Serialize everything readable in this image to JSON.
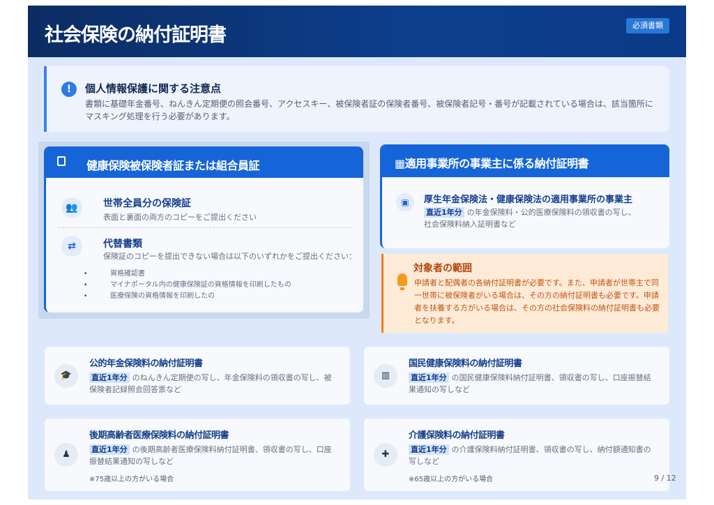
{
  "header": {
    "title": "社会保険の納付証明書",
    "badge": "必須書類"
  },
  "notice": {
    "icon": "exclamation-icon",
    "title": "個人情報保護に関する注意点",
    "text": "書類に基礎年金番号、ねんきん定期便の照会番号、アクセスキー、被保険者証の保険者番号、被保険者記号・番号が記載されている場合は、該当箇所にマスキング処理を行う必要があります。"
  },
  "insurance_card": {
    "icon": "document-icon",
    "title": "健康保険被保険者証または組合員証",
    "items": [
      {
        "icon": "family-icon",
        "title": "世帯全員分の保険証",
        "desc": "表面と裏面の両方のコピーをご提出ください"
      },
      {
        "icon": "swap-icon",
        "title": "代替書類",
        "desc": "保険証のコピーを提出できない場合は以下のいずれかをご提出ください：",
        "bullets": [
          "資格確認書",
          "マイナポータル内の健康保険証の資格情報を印刷したもの",
          "医療保険の資格情報を印刷したの"
        ]
      }
    ]
  },
  "employer_card": {
    "icon": "building-icon",
    "title": "適用事業所の事業主に係る納付証明書",
    "item": {
      "icon": "clipboard-icon",
      "title": "厚生年金保険法・健康保険法の適用事業所の事業主",
      "tag": "直近1年分",
      "desc": "の年金保険料・公的医療保険料の領収書の写し、社会保険料納入証明書など"
    }
  },
  "scope": {
    "icon": "lightbulb-icon",
    "title": "対象者の範囲",
    "text": "申請者と配偶者の各納付証明書が必要です。また、申請者が世帯主で同一世帯に被保険者がいる場合は、その方の納付証明書も必要です。申請者を扶養する方がいる場合は、その方の社会保険料の納付証明書も必要となります。"
  },
  "cards": [
    {
      "icon": "graduation-cap-icon",
      "glyph": "🎓",
      "title": "公的年金保険料の納付証明書",
      "tag": "直近1年分",
      "desc": "のねんきん定期便の写し、年金保険料の領収書の写し、被保険者記録照会回答票など",
      "note": ""
    },
    {
      "icon": "hospital-icon",
      "glyph": "▥",
      "title": "国民健康保険料の納付証明書",
      "tag": "直近1年分",
      "desc": "の国民健康保険料納付証明書、領収書の写し、口座振替結果通知の写しなど",
      "note": ""
    },
    {
      "icon": "elderly-person-icon",
      "glyph": "♟",
      "title": "後期高齢者医療保険料の納付証明書",
      "tag": "直近1年分",
      "desc": "の後期高齢者医療保険料納付証明書、領収書の写し、口座振替結果通知の写しなど",
      "note": "※75歳以上の方がいる場合"
    },
    {
      "icon": "care-hand-icon",
      "glyph": "✚",
      "title": "介護保険料の納付証明書",
      "tag": "直近1年分",
      "desc": "の介護保険料納付証明書、領収書の写し、納付額通知書の写しなど",
      "note": "※65歳以上の方がいる場合"
    }
  ],
  "page": {
    "number": "9 / 12"
  },
  "colors": {
    "header": "#0c2c63",
    "accent": "#1565d8",
    "warning": "#f27f1b",
    "background": "#dde9fb"
  }
}
